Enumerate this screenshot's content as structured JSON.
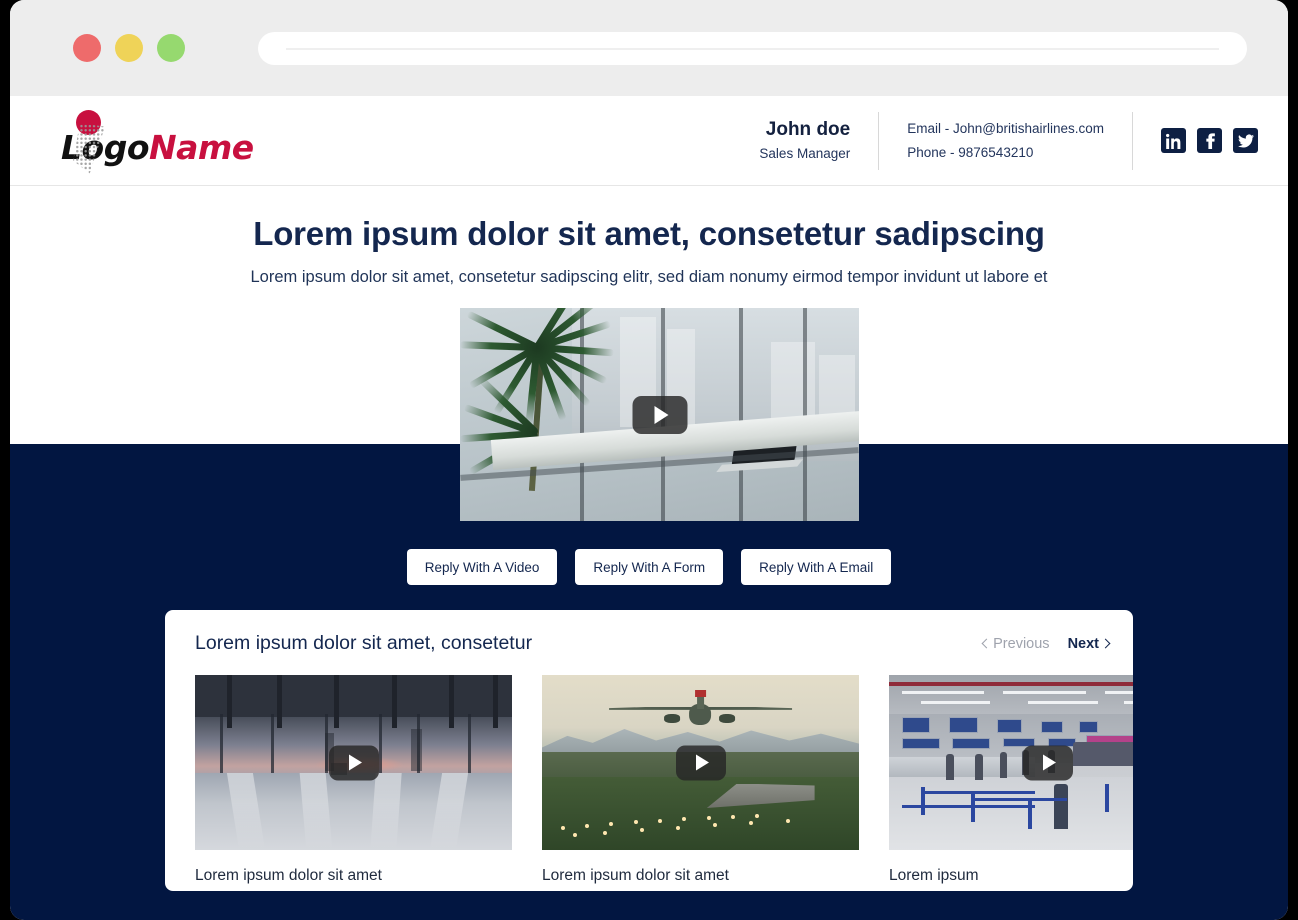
{
  "browser": {
    "traffic_lights": [
      "close",
      "minimize",
      "maximize"
    ],
    "url_value": "",
    "url_placeholder": ""
  },
  "header": {
    "logo": {
      "text_primary": "Logo",
      "text_secondary": "Name"
    },
    "person": {
      "name": "John doe",
      "role": "Sales Manager"
    },
    "contact": {
      "email_line": "Email - John@britishairlines.com",
      "phone_line": "Phone - 9876543210"
    },
    "socials": [
      {
        "name": "linkedin",
        "label": "LinkedIn"
      },
      {
        "name": "facebook",
        "label": "Facebook"
      },
      {
        "name": "twitter",
        "label": "Twitter"
      }
    ]
  },
  "hero": {
    "title": "Lorem ipsum dolor sit amet, consetetur sadipscing",
    "subtitle": "Lorem ipsum dolor sit amet, consetetur sadipscing elitr, sed diam nonumy eirmod tempor invidunt ut labore et"
  },
  "main_video": {
    "play_label": "Play",
    "scene": "office interior with palm plant, city windows and laptop on desk"
  },
  "reply_buttons": [
    {
      "label": "Reply With A Video"
    },
    {
      "label": "Reply With A Form"
    },
    {
      "label": "Reply With A Email"
    }
  ],
  "playlist": {
    "title": "Lorem ipsum dolor sit amet, consetetur",
    "pagination": {
      "previous": "Previous",
      "next": "Next",
      "previous_disabled": true
    },
    "items": [
      {
        "caption": "Lorem ipsum dolor sit amet",
        "scene": "airport terminal at sunset with traveler silhouettes"
      },
      {
        "caption": "Lorem ipsum dolor sit amet",
        "scene": "airplane landing over runway approach lights"
      },
      {
        "caption": "Lorem ipsum",
        "scene": "airport check-in hall with queues"
      }
    ]
  },
  "colors": {
    "navy": "#021641",
    "heading": "#14274f",
    "logo_accent": "#c8103f",
    "chrome": "#ededed",
    "light_red": "#ee6b6b",
    "light_yellow": "#efd358",
    "light_green": "#96d96f"
  }
}
